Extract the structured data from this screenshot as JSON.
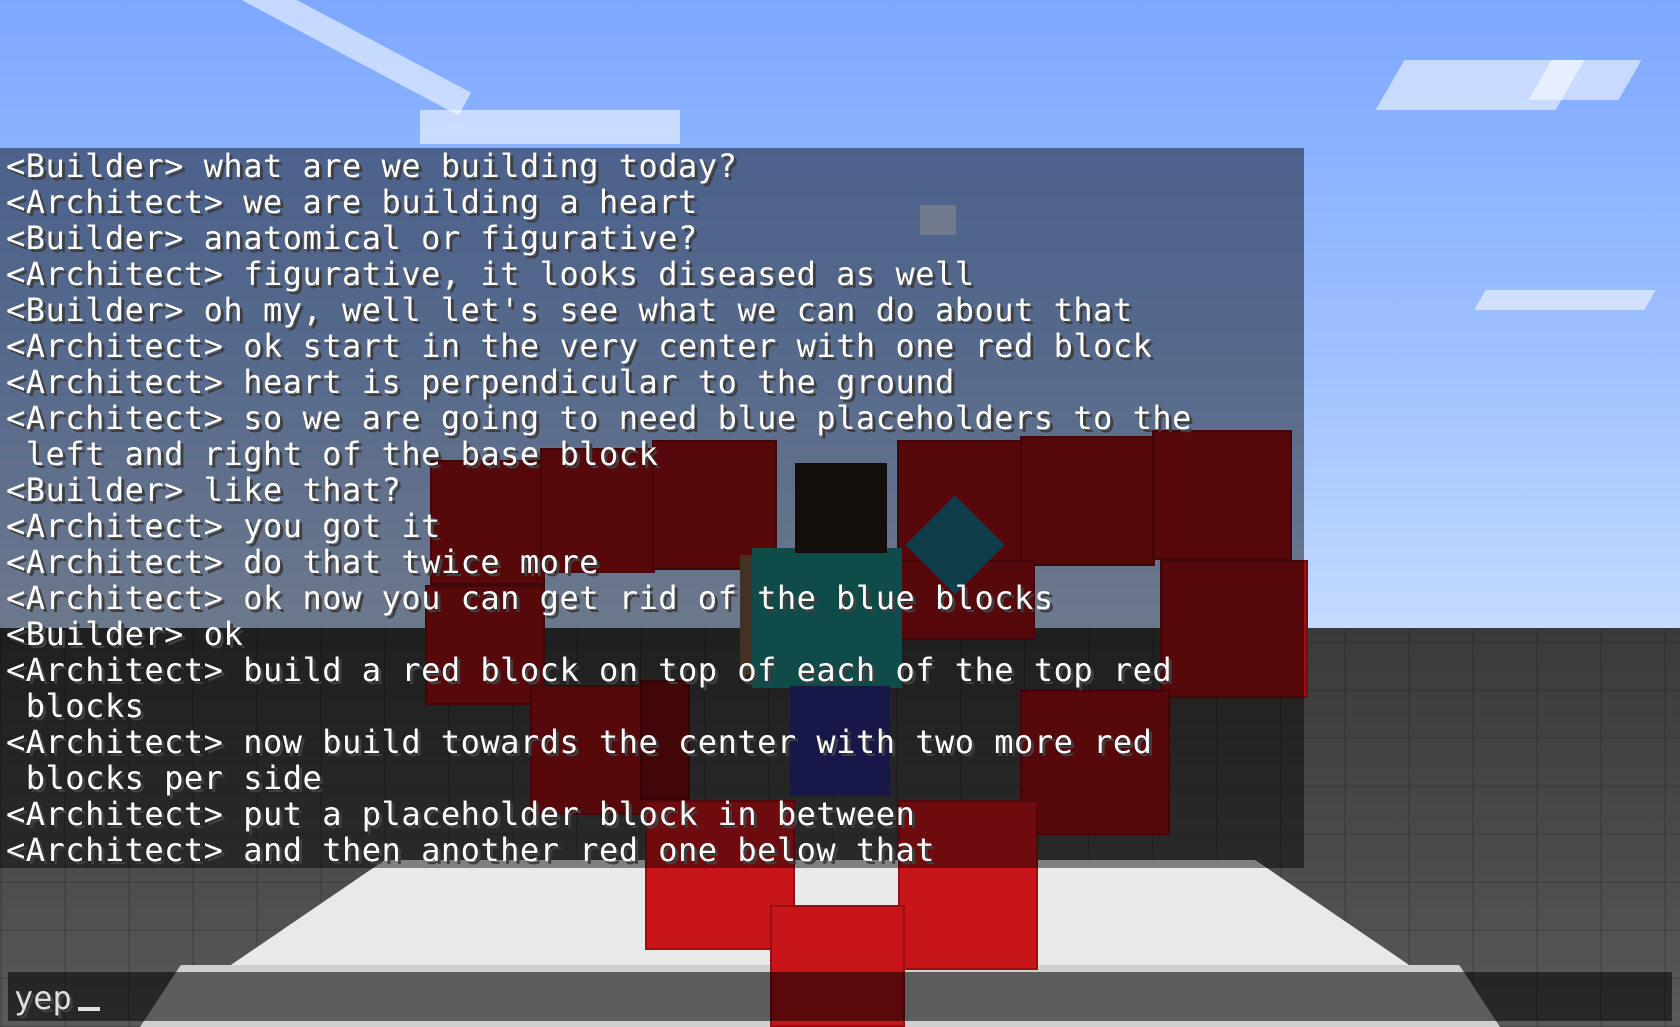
{
  "chat": {
    "messages": [
      "<Builder> what are we building today?",
      "<Architect> we are building a heart",
      "<Builder> anatomical or figurative?",
      "<Architect> figurative, it looks diseased as well",
      "<Builder> oh my, well let's see what we can do about that",
      "<Architect> ok start in the very center with one red block",
      "<Architect> heart is perpendicular to the ground",
      "<Architect> so we are going to need blue placeholders to the",
      " left and right of the base block",
      "<Builder> like that?",
      "<Architect> you got it",
      "<Architect> do that twice more",
      "<Architect> ok now you can get rid of the blue blocks",
      "<Builder> ok",
      "<Architect> build a red block on top of each of the top red",
      " blocks",
      "<Architect> now build towards the center with two more red",
      " blocks per side",
      "<Architect> put a placeholder block in between",
      "<Architect> and then another red one below that"
    ],
    "input_value": "yep"
  },
  "colors": {
    "sky": "#7faaff",
    "block_red": "#9e1014",
    "chat_text": "#ffffff"
  }
}
